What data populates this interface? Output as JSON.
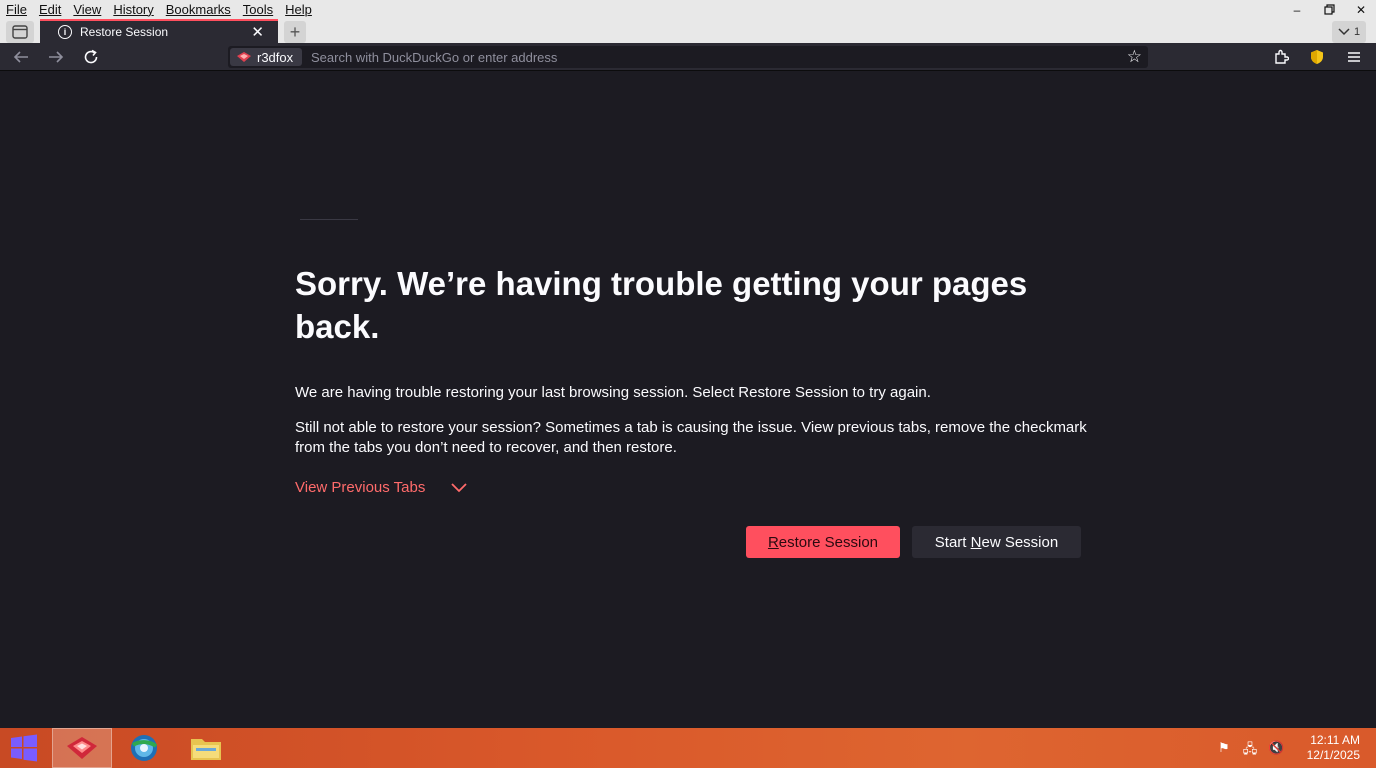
{
  "menubar": {
    "items": [
      "File",
      "Edit",
      "View",
      "History",
      "Bookmarks",
      "Tools",
      "Help"
    ]
  },
  "window_controls": {
    "minimize": "–",
    "restore": "🗗",
    "close": "✕"
  },
  "tab": {
    "title": "Restore Session",
    "close_glyph": "✕",
    "new_tab_glyph": "+",
    "count_label": "1"
  },
  "urlbar": {
    "identity_label": "r3dfox",
    "placeholder": "Search with DuckDuckGo or enter address"
  },
  "content": {
    "heading": "Sorry. We’re having trouble getting your pages back.",
    "paragraph1": "We are having trouble restoring your last browsing session. Select Restore Session to try again.",
    "paragraph2": "Still not able to restore your session? Sometimes a tab is causing the issue. View previous tabs, remove the checkmark from the tabs you don’t need to recover, and then restore.",
    "view_previous_tabs": "View Previous Tabs",
    "restore_button": {
      "accesskey": "R",
      "rest": "estore Session"
    },
    "new_session_button": {
      "before": "Start ",
      "accesskey": "N",
      "after": "ew Session"
    }
  },
  "taskbar": {
    "time": "12:11 AM",
    "date": "12/1/2025"
  },
  "colors": {
    "accent": "#ff4f5e",
    "link": "#ff6b6b",
    "background": "#1c1b22",
    "toolbar": "#2b2a33"
  }
}
